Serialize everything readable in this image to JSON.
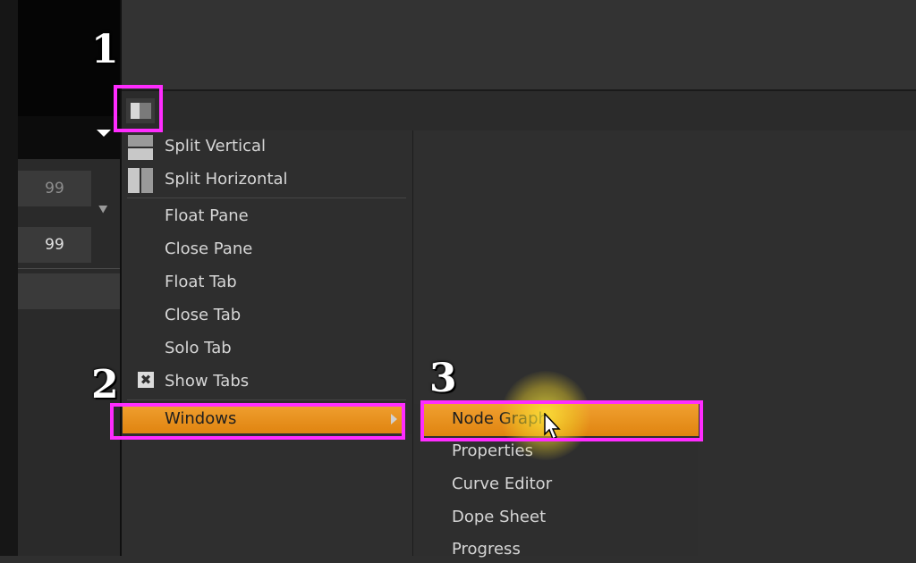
{
  "left_panel": {
    "field_values": [
      "99",
      "99"
    ]
  },
  "context_menu": {
    "items": [
      {
        "label": "Split Vertical",
        "icon": "split-vertical-icon"
      },
      {
        "label": "Split Horizontal",
        "icon": "split-horizontal-icon"
      },
      {
        "label": "Float Pane"
      },
      {
        "label": "Close Pane"
      },
      {
        "label": "Float Tab"
      },
      {
        "label": "Close Tab"
      },
      {
        "label": "Solo Tab"
      },
      {
        "label": "Show Tabs",
        "checked": true
      },
      {
        "label": "Windows",
        "has_submenu": true,
        "highlighted": true
      }
    ]
  },
  "submenu": {
    "items": [
      {
        "label": "Node Graph",
        "highlighted": true
      },
      {
        "label": "Properties"
      },
      {
        "label": "Curve Editor"
      },
      {
        "label": "Dope Sheet"
      },
      {
        "label": "Progress"
      }
    ]
  },
  "annotations": {
    "numbers": [
      "1",
      "2",
      "3"
    ],
    "box_color": "#ff2cff"
  },
  "colors": {
    "highlight": "#e8901c"
  }
}
